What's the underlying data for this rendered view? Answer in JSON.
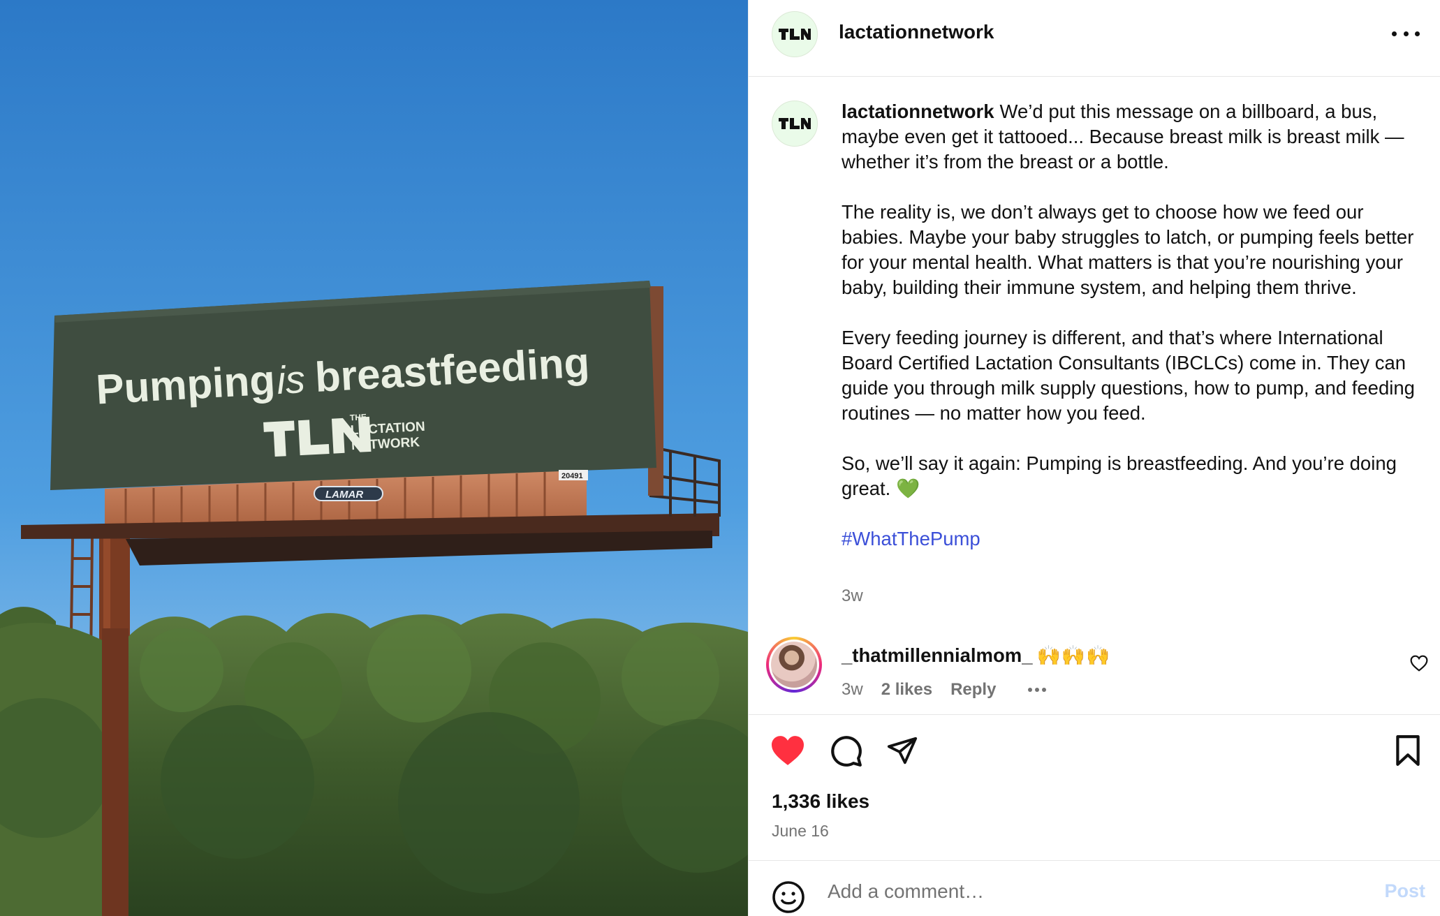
{
  "post": {
    "username": "lactationnetwork",
    "logo_text": "TLN"
  },
  "image": {
    "billboard_headline_1": "Pumping",
    "billboard_headline_is": "is",
    "billboard_headline_2": "breastfeeding",
    "billboard_logo_the": "THE",
    "billboard_logo_line1": "LACTATION",
    "billboard_logo_line2": "NETWORK",
    "billboard_brand": "LAMAR",
    "billboard_number": "20491"
  },
  "caption": {
    "username": "lactationnetwork",
    "paragraph_1": "We’d put this message on a billboard, a bus, maybe even get it tattooed... Because breast milk is breast milk — whether it’s from the breast or a bottle.",
    "paragraph_2": "The reality is, we don’t always get to choose how we feed our babies. Maybe your baby struggles to latch, or pumping feels better for your mental health. What matters is that you’re nourishing your baby, building their immune system, and helping them thrive.",
    "paragraph_3": "Every feeding journey is different, and that’s where International Board Certified Lactation Consultants (IBCLCs) come in. They can guide you through milk supply questions, how to pump, and feeding routines — no matter how you feed.",
    "paragraph_4": "So, we’ll say it again: Pumping is breastfeeding. And you’re doing great. 💚",
    "hashtag": "#WhatThePump",
    "time": "3w"
  },
  "comment": {
    "username": "_thatmillennialmom_",
    "emoji": "🙌🙌🙌",
    "time": "3w",
    "likes": "2 likes",
    "reply": "Reply"
  },
  "actions": {
    "likes_count": "1,336 likes",
    "date": "June 16",
    "liked": true
  },
  "add_comment": {
    "placeholder": "Add a comment…",
    "post_label": "Post"
  },
  "colors": {
    "like_red": "#ff3040",
    "link_blue": "#3b4fd8",
    "post_button_disabled": "#c2d9fb",
    "billboard_green": "#3f4d40",
    "billboard_text": "#e9efe2",
    "sky": "#3d8ed4"
  }
}
